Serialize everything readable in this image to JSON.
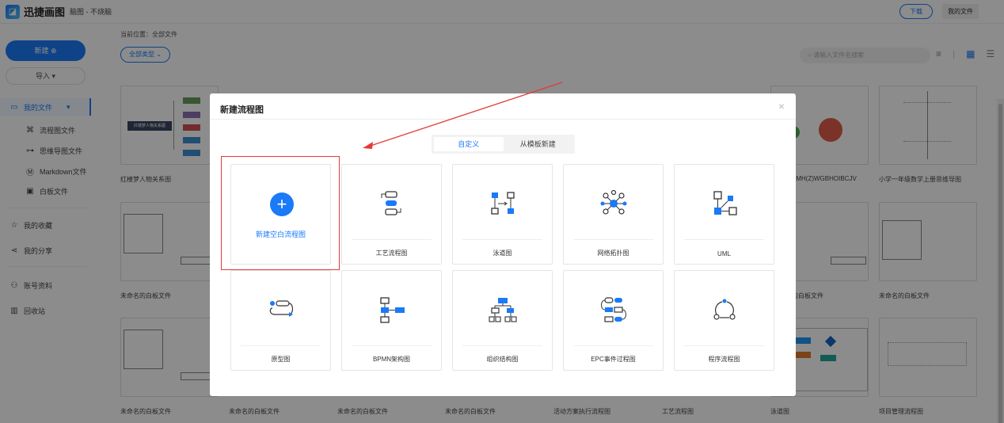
{
  "header": {
    "logo_glyph": "◪",
    "app_name": "迅捷画图",
    "doc_title": "脑图 - 不烧脑",
    "download_label": "下载",
    "my_files_label": "我的文件"
  },
  "sidebar": {
    "new_label": "新建 ⊕",
    "import_label": "导入 ▾",
    "items": [
      {
        "label": "我的文件",
        "icon": "folder-icon",
        "glyph": "▭",
        "arrow": "▾"
      },
      {
        "label": "流程图文件",
        "icon": "flowchart-icon",
        "glyph": "⌘"
      },
      {
        "label": "思维导图文件",
        "icon": "mindmap-icon",
        "glyph": "⊶"
      },
      {
        "label": "Markdown文件",
        "icon": "markdown-icon",
        "glyph": "Ⓜ"
      },
      {
        "label": "白板文件",
        "icon": "whiteboard-icon",
        "glyph": "▣"
      },
      {
        "label": "我的收藏",
        "icon": "star-icon",
        "glyph": "☆"
      },
      {
        "label": "我的分享",
        "icon": "share-icon",
        "glyph": "⋖"
      },
      {
        "label": "账号资料",
        "icon": "user-icon",
        "glyph": "⚇"
      },
      {
        "label": "回收站",
        "icon": "trash-icon",
        "glyph": "▥"
      }
    ]
  },
  "content": {
    "breadcrumb": "当前位置：全部文件",
    "filter_label": "全部类型 ⌄",
    "search_placeholder": "请输入文件名搜索",
    "search_glyph": "○",
    "view_icons": [
      "≡",
      "|",
      "▦",
      "☰"
    ],
    "files_row1": [
      "红楼梦人物关系图",
      "AMH(Z)WGBHOIBCJV",
      "小学一年级数学上册思维导图"
    ],
    "files_row2": [
      "未命名的白板文件",
      "的白板文件",
      "未命名的白板文件"
    ],
    "files_row3": [
      "未命名的白板文件",
      "未命名的白板文件",
      "未命名的白板文件",
      "未命名的白板文件",
      "活动方案执行流程图",
      "工艺流程图",
      "泳道图",
      "项目管理流程图"
    ],
    "thumb_text": "红楼梦人物关系图"
  },
  "modal": {
    "title": "新建流程图",
    "close_glyph": "×",
    "tabs": [
      {
        "label": "自定义",
        "selected": true
      },
      {
        "label": "从模板新建",
        "selected": false
      }
    ],
    "blank": {
      "plus": "+",
      "label": "新建空白流程图"
    },
    "templates": [
      "工艺流程图",
      "泳道图",
      "网络拓扑图",
      "UML",
      "原型图",
      "BPMN架构图",
      "组织结构图",
      "EPC事件过程图",
      "程序流程图"
    ]
  },
  "colors": {
    "accent": "#1a7af8",
    "highlight": "#e53935"
  }
}
